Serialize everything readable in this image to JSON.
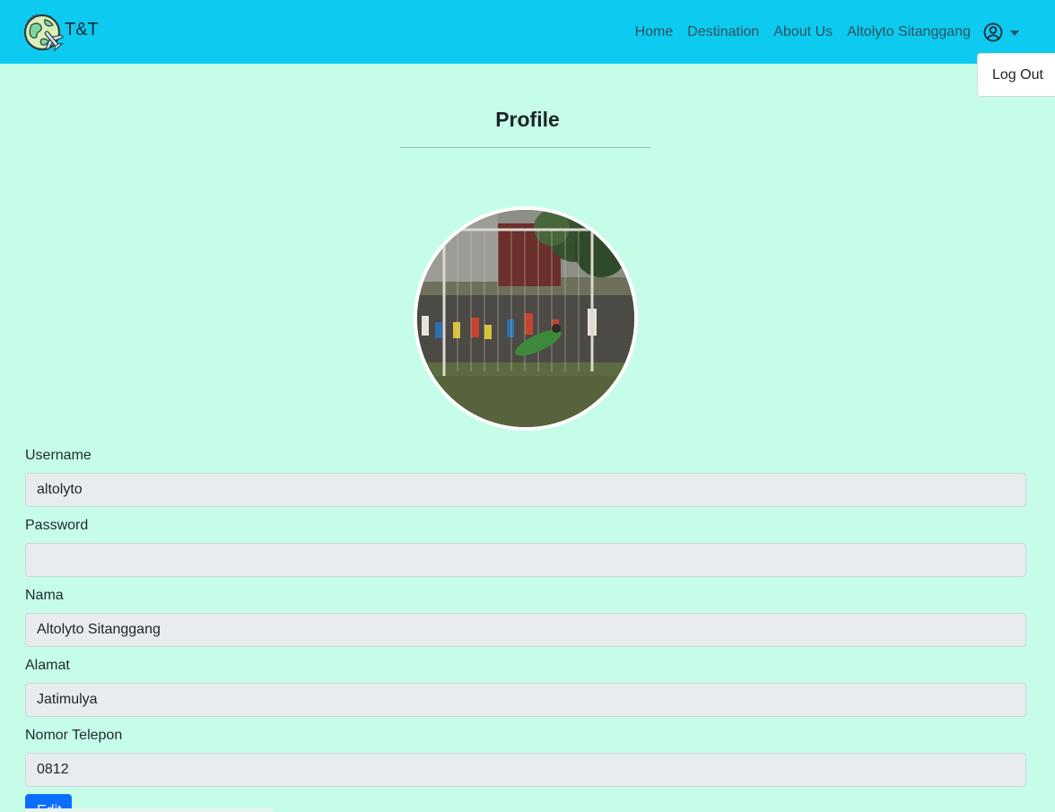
{
  "brand": {
    "name": "T&T"
  },
  "nav": {
    "links": [
      "Home",
      "Destination",
      "About Us"
    ],
    "user_name": "Altolyto Sitanggang",
    "user_icon": "user-circle-icon"
  },
  "dropdown": {
    "logout_label": "Log Out"
  },
  "page": {
    "title": "Profile"
  },
  "form": {
    "username": {
      "label": "Username",
      "value": "altolyto"
    },
    "password": {
      "label": "Password",
      "value": ""
    },
    "nama": {
      "label": "Nama",
      "value": "Altolyto Sitanggang"
    },
    "alamat": {
      "label": "Alamat",
      "value": "Jatimulya"
    },
    "telepon": {
      "label": "Nomor Telepon",
      "value": "0812"
    },
    "edit_label": "Edit"
  },
  "colors": {
    "navbar": "#0dcaf0",
    "background": "#c6fde9",
    "input_bg": "#e9ecef",
    "primary": "#0d6efd"
  }
}
